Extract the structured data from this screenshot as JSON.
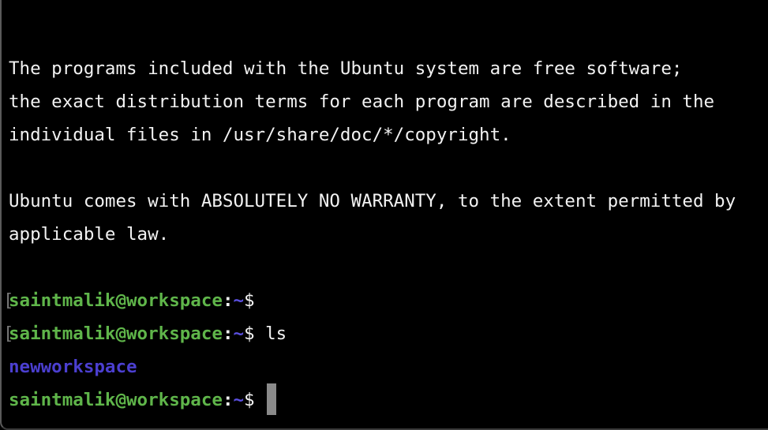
{
  "colors": {
    "background": "#000000",
    "text": "#f2f2f2",
    "prompt_user": "#5fb54a",
    "prompt_path": "#5a4fe0",
    "directory": "#4b3fd0",
    "cursor": "#8a8a8a"
  },
  "output": {
    "motd_1": "The programs included with the Ubuntu system are free software;",
    "motd_2": "the exact distribution terms for each program are described in the",
    "motd_3": "individual files in /usr/share/doc/*/copyright.",
    "warranty_1": "Ubuntu comes with ABSOLUTELY NO WARRANTY, to the extent permitted by",
    "warranty_2": "applicable law."
  },
  "prompt": {
    "user_host": "saintmalik@workspace",
    "colon": ":",
    "path": "~",
    "dollar": "$"
  },
  "commands": {
    "cmd1": "",
    "cmd2": "ls"
  },
  "ls_output": {
    "dir1": "newworkspace"
  }
}
